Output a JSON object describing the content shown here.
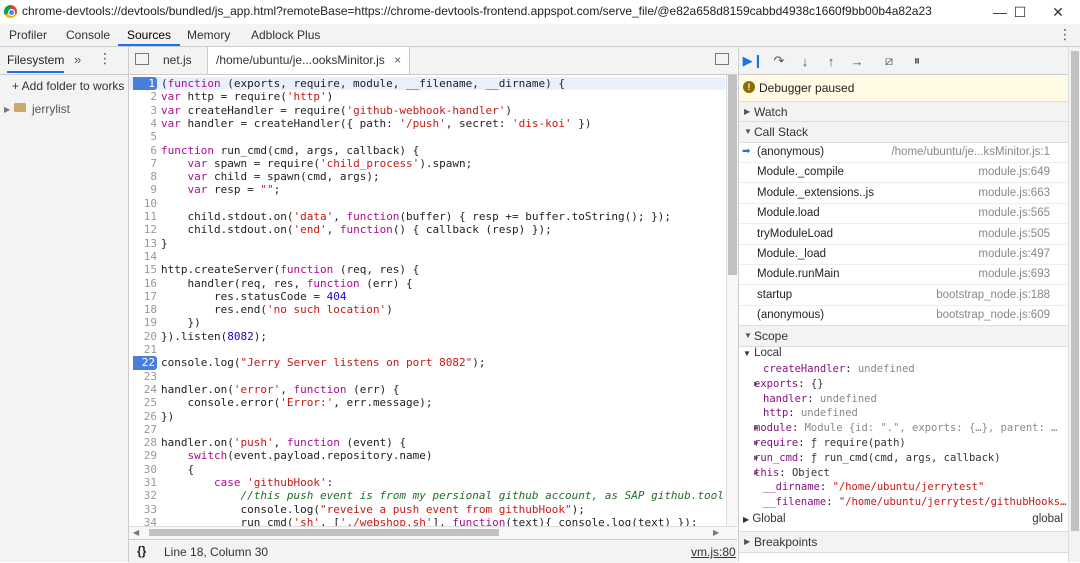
{
  "window": {
    "title": "chrome-devtools://devtools/bundled/js_app.html?remoteBase=https://chrome-devtools-frontend.appspot.com/serve_file/@e82a658d8159cabbd4938c1660f9bb00b4a82a23/&dockSide=undocked",
    "minimize": "—",
    "maximize": "☐",
    "close": "✕"
  },
  "tabs": [
    {
      "label": "Profiler"
    },
    {
      "label": "Console"
    },
    {
      "label": "Sources"
    },
    {
      "label": "Memory"
    },
    {
      "label": "Adblock Plus"
    }
  ],
  "more_menu": "⋮",
  "navigator": {
    "tab": "Filesystem",
    "more": "»",
    "add_folder": "+ Add folder to works",
    "folder": "jerrylist"
  },
  "editor_tabs": [
    {
      "label": "net.js"
    },
    {
      "label": "/home/ubuntu/je...ooksMinitor.js",
      "close": "×"
    }
  ],
  "code": [
    {
      "n": "1",
      "html": "(function (exports, require, module, __filename, __dirname) {",
      "bp": true
    },
    {
      "n": "2",
      "html": "var http = require('http')"
    },
    {
      "n": "3",
      "html": "var createHandler = require('github-webhook-handler')"
    },
    {
      "n": "4",
      "html": "var handler = createHandler({ path: '/push', secret: 'dis-koi' })"
    },
    {
      "n": "5",
      "html": ""
    },
    {
      "n": "6",
      "html": "function run_cmd(cmd, args, callback) {"
    },
    {
      "n": "7",
      "html": "    var spawn = require('child_process').spawn;"
    },
    {
      "n": "8",
      "html": "    var child = spawn(cmd, args);"
    },
    {
      "n": "9",
      "html": "    var resp = \"\";"
    },
    {
      "n": "10",
      "html": ""
    },
    {
      "n": "11",
      "html": "    child.stdout.on('data', function(buffer) { resp += buffer.toString(); });"
    },
    {
      "n": "12",
      "html": "    child.stdout.on('end', function() { callback (resp) });"
    },
    {
      "n": "13",
      "html": "}"
    },
    {
      "n": "14",
      "html": ""
    },
    {
      "n": "15",
      "html": "http.createServer(function (req, res) {"
    },
    {
      "n": "16",
      "html": "    handler(req, res, function (err) {"
    },
    {
      "n": "17",
      "html": "        res.statusCode = 404"
    },
    {
      "n": "18",
      "html": "        res.end('no such location')"
    },
    {
      "n": "19",
      "html": "    })"
    },
    {
      "n": "20",
      "html": "}).listen(8082);"
    },
    {
      "n": "21",
      "html": ""
    },
    {
      "n": "22",
      "html": "console.log(\"Jerry Server listens on port 8082\");",
      "bp": true
    },
    {
      "n": "23",
      "html": ""
    },
    {
      "n": "24",
      "html": "handler.on('error', function (err) {"
    },
    {
      "n": "25",
      "html": "    console.error('Error:', err.message);"
    },
    {
      "n": "26",
      "html": "})"
    },
    {
      "n": "27",
      "html": ""
    },
    {
      "n": "28",
      "html": "handler.on('push', function (event) {"
    },
    {
      "n": "29",
      "html": "    switch(event.payload.repository.name)"
    },
    {
      "n": "30",
      "html": "    {"
    },
    {
      "n": "31",
      "html": "        case 'githubHook':"
    },
    {
      "n": "32",
      "html": "            //this push event is from my persional github account, as SAP github.tool's gith"
    },
    {
      "n": "33",
      "html": "            console.log(\"reveive a push event from githubHook\");"
    },
    {
      "n": "34",
      "html": "            run_cmd('sh', ['./webshop.sh'], function(text){ console.log(text) });"
    }
  ],
  "status_bar": {
    "braces": "{}",
    "position": "Line 18, Column 30",
    "source": "vm.js:80"
  },
  "debugger": {
    "paused": "Debugger paused",
    "watch": "Watch",
    "call_stack": "Call Stack",
    "scope": "Scope",
    "breakpoints": "Breakpoints",
    "frames": [
      {
        "fn": "(anonymous)",
        "loc": "/home/ubuntu/je...ksMinitor.js:1",
        "current": true
      },
      {
        "fn": "Module._compile",
        "loc": "module.js:649"
      },
      {
        "fn": "Module._extensions..js",
        "loc": "module.js:663"
      },
      {
        "fn": "Module.load",
        "loc": "module.js:565"
      },
      {
        "fn": "tryModuleLoad",
        "loc": "module.js:505"
      },
      {
        "fn": "Module._load",
        "loc": "module.js:497"
      },
      {
        "fn": "Module.runMain",
        "loc": "module.js:693"
      },
      {
        "fn": "startup",
        "loc": "bootstrap_node.js:188"
      },
      {
        "fn": "(anonymous)",
        "loc": "bootstrap_node.js:609"
      }
    ],
    "local": "Local",
    "scope_items": [
      {
        "tri": "",
        "key": "createHandler",
        "val": "undefined",
        "kind": "g"
      },
      {
        "tri": "▶",
        "key": "exports",
        "val": "{}",
        "kind": "v"
      },
      {
        "tri": "",
        "key": "handler",
        "val": "undefined",
        "kind": "g"
      },
      {
        "tri": "",
        "key": "http",
        "val": "undefined",
        "kind": "g"
      },
      {
        "tri": "▶",
        "key": "module",
        "val": "Module {id: \".\", exports: {…}, parent: …",
        "kind": "g"
      },
      {
        "tri": "▶",
        "key": "require",
        "val": "ƒ require(path)",
        "kind": "v"
      },
      {
        "tri": "▶",
        "key": "run_cmd",
        "val": "ƒ run_cmd(cmd, args, callback)",
        "kind": "v"
      },
      {
        "tri": "▶",
        "key": "this",
        "val": "Object",
        "kind": "v"
      },
      {
        "tri": "",
        "key": "__dirname",
        "val": "\"/home/ubuntu/jerrytest\"",
        "kind": "s"
      },
      {
        "tri": "",
        "key": "__filename",
        "val": "\"/home/ubuntu/jerrytest/githubHooks…",
        "kind": "s"
      }
    ],
    "global": "Global",
    "global_value": "global"
  },
  "colors": {
    "accent": "#1a73e8",
    "breakpoint": "#4a7ede",
    "paused_bg": "#fffbe5"
  }
}
